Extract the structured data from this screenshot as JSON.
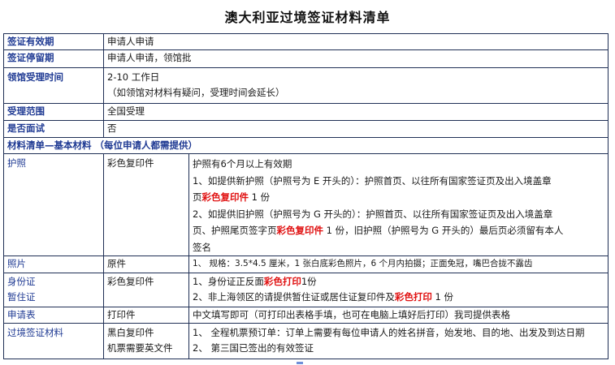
{
  "title": "澳大利亚过境签证材料清单",
  "rows": {
    "validity": {
      "label": "签证有效期",
      "value": "申请人申请"
    },
    "stay": {
      "label": "签证停留期",
      "value": "申请人申请，领馆批"
    },
    "processing": {
      "label": "领馆受理时间",
      "line1": "2-10 工作日",
      "line2": "（如领馆对材料有疑问，受理时间会延长）"
    },
    "scope": {
      "label": "受理范围",
      "value": "全国受理"
    },
    "interview": {
      "label": "是否面试",
      "value": "否"
    }
  },
  "section_header": "材料清单—基本材料 （每位申请人都需提供）",
  "passport": {
    "label": "护照",
    "type": "彩色复印件",
    "line1": "护照有6个月以上有效期",
    "line2a": "1、如提供新护照（护照号为 E 开头的）：护照首页、以往所有国家签证页及出入境盖章",
    "line2b_pre": "页",
    "line2b_red": "彩色复印件",
    "line2b_post": " 1 份",
    "line3a": "2、如提供旧护照（护照号为 G 开头的）：护照首页、以往所有国家签证页及出入境盖章",
    "line3b_pre": "页、护照尾页签字页",
    "line3b_red": "彩色复印件",
    "line3b_post": " 1 份，旧护照（护照号为 G 开头的）最后页必须留有本人",
    "line3c": "签名"
  },
  "photo": {
    "label": "照片",
    "type": "原件",
    "desc": "1、 规格：3.5*4.5 厘米，1 张白底彩色照片，6 个月内拍摄；正面免冠，嘴巴合拢不露齿"
  },
  "id_card": {
    "label1": "身份证",
    "label2": "暂住证",
    "type": "彩色复印件",
    "line1_pre": "1、身份证正反面",
    "line1_red": "彩色打印",
    "line1_post": "1份",
    "line2_pre": "2、非上海领区的请提供暂住证或居住证复印件及",
    "line2_red": "彩色打印",
    "line2_post": " 1 份"
  },
  "application": {
    "label": "申请表",
    "type": "打印件",
    "desc": "中文填写即可（可打印出表格手填，也可在电脑上填好后打印）我司提供表格"
  },
  "transit": {
    "label": "过境签证材料",
    "type1": "黑白复印件",
    "type2": "机票需要英文件",
    "line1": "1、 全程机票预订单：订单上需要有每位申请人的姓名拼音，始发地、目的地、出发及到达日期",
    "line2": "2、 第三国已签出的有效签证"
  }
}
